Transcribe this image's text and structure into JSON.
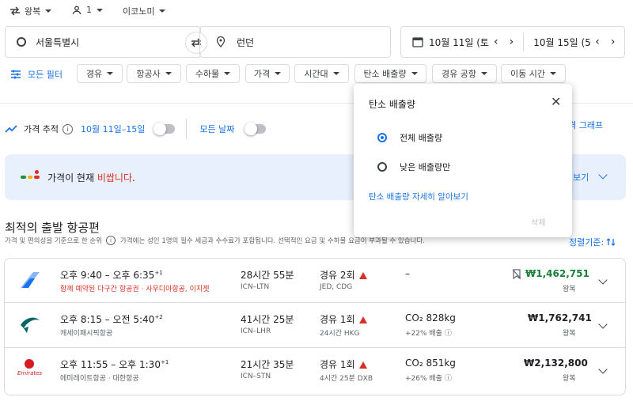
{
  "trip": {
    "type": "왕복",
    "passengers": "1",
    "cabin": "이코노미"
  },
  "search": {
    "origin": "서울특별시",
    "destination": "런던",
    "depart_date": "10월 11일 (토",
    "return_date": "10월 15일 (5"
  },
  "filters": {
    "all_filters": "모든 필터",
    "chips": [
      "경유",
      "항공사",
      "수하물",
      "가격",
      "시간대",
      "탄소 배출량",
      "경유 공항",
      "이동 시간"
    ]
  },
  "tracking": {
    "label": "가격 추적",
    "dates_option": "10월 11일–15일",
    "any_dates": "모든 날짜",
    "price_graph": "가격 그래프"
  },
  "price_banner": {
    "prefix": "가격이 현재 ",
    "level": "비쌉니다",
    "suffix": ".",
    "link": "보기"
  },
  "best": {
    "title": "최적의 출발 항공편",
    "note_start": "가격 및 편의성을 기준으로 한 순위",
    "note_tail": "가격에는 성인 1명의 필수 세금과 수수료가 포함됩니다. 선택적인 요금 및 수하물 요금이 부과될 수 있습니다.",
    "sort_label": "정렬기준:"
  },
  "flights": [
    {
      "times": "오후 9:40 – 오후 6:35",
      "plus": "+1",
      "airline": "함께 예약된 다구간 항공권 · 사우디아항공, 이지젯",
      "duration": "28시간 55분",
      "route": "ICN–LTN",
      "stops": "경유 2회",
      "stops_detail": "JED, CDG",
      "co2": "–",
      "co2_sub": "",
      "price": "₩1,462,751",
      "price_type": "왕복"
    },
    {
      "times": "오후 8:15 – 오전 5:40",
      "plus": "+2",
      "airline": "캐세이패시픽항공",
      "duration": "41시간 25분",
      "route": "ICN–LHR",
      "stops": "경유 1회",
      "stops_detail": "24시간 HKG",
      "co2": "CO₂ 828kg",
      "co2_sub": "+22% 배출",
      "price": "₩1,762,741",
      "price_type": "왕복"
    },
    {
      "times": "오후 11:55 – 오후 1:30",
      "plus": "+1",
      "airline": "에미레이트항공 · 대한항공",
      "duration": "21시간 35분",
      "route": "ICN–STN",
      "stops": "경유 1회",
      "stops_detail": "4시간 25분 DXB",
      "co2": "CO₂ 851kg",
      "co2_sub": "+26% 배출",
      "price": "₩2,132,800",
      "price_type": "왕복",
      "logo_text": "Emirates"
    }
  ],
  "popup": {
    "title": "탄소 배출량",
    "options": [
      "전체 배출량",
      "낮은 배출량만"
    ],
    "selected": "전체 배출량",
    "learn_more": "탄소 배출량 자세히 알아보기",
    "clear": "삭제"
  },
  "colors": {
    "accent": "#1a73e8",
    "warning": "#d93025",
    "price_low": "#188038"
  }
}
